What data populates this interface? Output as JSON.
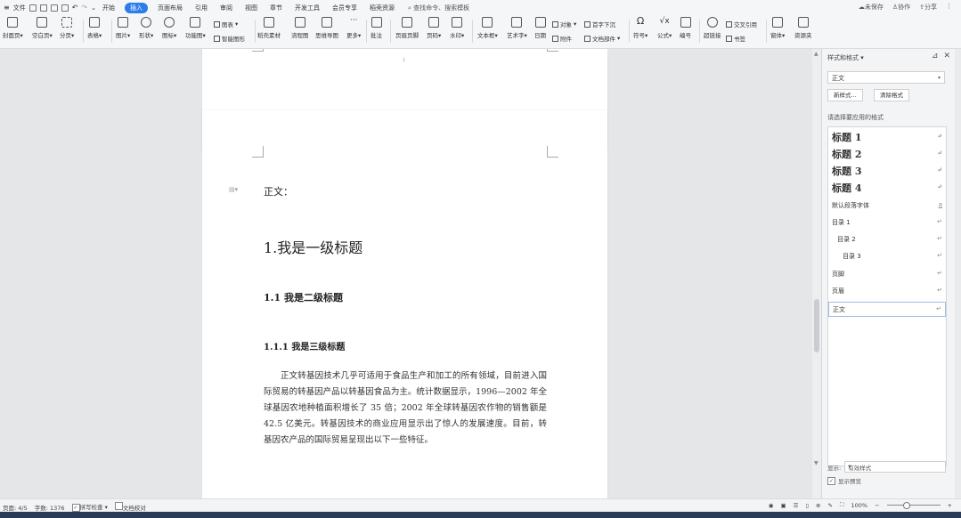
{
  "menubar": {
    "file_label": "文件",
    "tabs": [
      "开始",
      "插入",
      "页面布局",
      "引用",
      "审阅",
      "视图",
      "章节",
      "开发工具",
      "会员专享",
      "稻壳资源"
    ],
    "active_tab": "插入",
    "search_placeholder": "查找命令、搜索模板",
    "unsaved": "未保存",
    "collab": "协作",
    "share": "分享"
  },
  "ribbon": {
    "cover": "封面页",
    "blank": "空白页",
    "pagebreak": "分页",
    "table": "表格",
    "picture": "图片",
    "shape": "形状",
    "icon": "图标",
    "funcchart": "功能图",
    "chart": "图表",
    "smartart": "智能图形",
    "material": "稻壳素材",
    "flowchart": "流程图",
    "mindmap": "思维导图",
    "more": "更多",
    "comment": "批注",
    "header_footer": "页眉页脚",
    "pagenum": "页码",
    "watermark": "水印",
    "textbox": "文本框",
    "wordart": "艺术字",
    "date": "日期",
    "object": "对象",
    "dropcap": "首字下沉",
    "attachment": "附件",
    "docpart": "文档部件",
    "symbol": "符号",
    "formula": "公式",
    "numbering": "编号",
    "hyperlink": "超链接",
    "crossref": "交叉引用",
    "bookmark": "书签",
    "font": "窗体",
    "resource": "资源夹"
  },
  "document": {
    "page1_marker": "1",
    "line_zhengwen": "正文：",
    "h1": "1.我是一级标题",
    "h2": "1.1 我是二级标题",
    "h3": "1.1.1 我是三级标题",
    "paragraph": "正文转基因技术几乎可适用于食品生产和加工的所有领域，目前进入国际贸易的转基因产品以转基因食品为主。统计数据显示，1996—2002 年全球基因农地种植面积增长了 35 倍；2002 年全球转基因农作物的销售额是 42.5 亿美元。转基因技术的商业应用显示出了惊人的发展速度。目前，转基因农产品的国际贸易呈现出以下一些特征。"
  },
  "styles_pane": {
    "title": "样式和格式",
    "current_style": "正文",
    "new_style": "新样式...",
    "clear_format": "清除格式",
    "pick_label": "请选择要应用的格式",
    "items": [
      {
        "label": "标题  1",
        "kind": "heading"
      },
      {
        "label": "标题  2",
        "kind": "heading"
      },
      {
        "label": "标题  3",
        "kind": "heading"
      },
      {
        "label": "标题  4",
        "kind": "heading"
      },
      {
        "label": "默认段落字体",
        "kind": "plain",
        "mark": "a"
      },
      {
        "label": "目录  1",
        "kind": "plain"
      },
      {
        "label": "目录  2",
        "kind": "plain"
      },
      {
        "label": "目录  3",
        "kind": "plain"
      },
      {
        "label": "页脚",
        "kind": "plain"
      },
      {
        "label": "页眉",
        "kind": "plain"
      },
      {
        "label": "正文",
        "kind": "plain",
        "selected": true
      }
    ],
    "paragraph_mark": "↵",
    "show_label": "显示:",
    "show_value": "有效样式",
    "preview_label": "显示预览"
  },
  "statusbar": {
    "page": "页面: 4/5",
    "words": "字数: 1376",
    "spellcheck": "拼写检查",
    "proofread": "文档校对",
    "zoom": "100%"
  }
}
